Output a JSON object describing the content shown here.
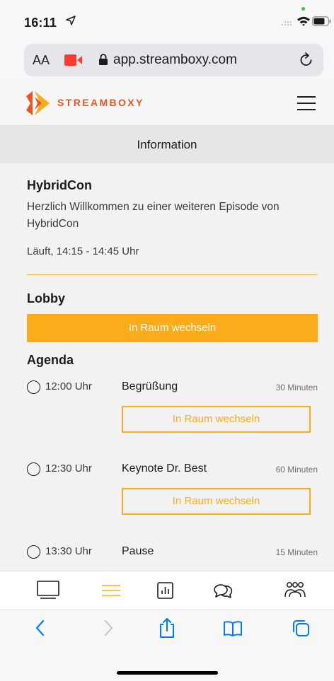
{
  "status_bar": {
    "time": "16:11",
    "location_icon": "location-arrow-icon",
    "signal_icon": "cellular-signal-icon",
    "wifi_icon": "wifi-icon",
    "battery_icon": "battery-icon"
  },
  "browser": {
    "text_size_label": "AA",
    "camera_icon": "camera-recording-icon",
    "lock_icon": "lock-icon",
    "url": "app.streamboxy.com",
    "reload_icon": "reload-icon"
  },
  "site_header": {
    "brand": "STREAMBOXY",
    "brand_color": "#f0531c",
    "menu_icon": "hamburger-menu-icon"
  },
  "page_title": "Information",
  "event": {
    "title": "HybridCon",
    "description": "Herzlich Willkommen zu einer weiteren Episode von HybridCon",
    "status_time": "Läuft, 14:15 - 14:45 Uhr"
  },
  "lobby": {
    "title": "Lobby",
    "button_label": "In Raum wechseln"
  },
  "agenda": {
    "title": "Agenda",
    "items": [
      {
        "time": "12:00 Uhr",
        "title": "Begrüßung",
        "duration": "30 Minuten",
        "button_label": "In Raum wechseln"
      },
      {
        "time": "12:30 Uhr",
        "title": "Keynote Dr. Best",
        "duration": "60 Minuten",
        "button_label": "In Raum wechseln"
      },
      {
        "time": "13:30 Uhr",
        "title": "Pause",
        "duration": "15 Minuten"
      }
    ]
  },
  "app_nav": {
    "items": [
      "monitor-icon",
      "list-icon",
      "poll-chart-icon",
      "chat-bubbles-icon",
      "participants-icon"
    ],
    "active": "list-icon"
  },
  "safari_toolbar": {
    "items": [
      "back-icon",
      "forward-icon",
      "share-icon",
      "bookmarks-icon",
      "tabs-icon"
    ]
  },
  "colors": {
    "accent": "#fbac1a",
    "ios_blue": "#007aff",
    "camera_red": "#ff3b30"
  }
}
